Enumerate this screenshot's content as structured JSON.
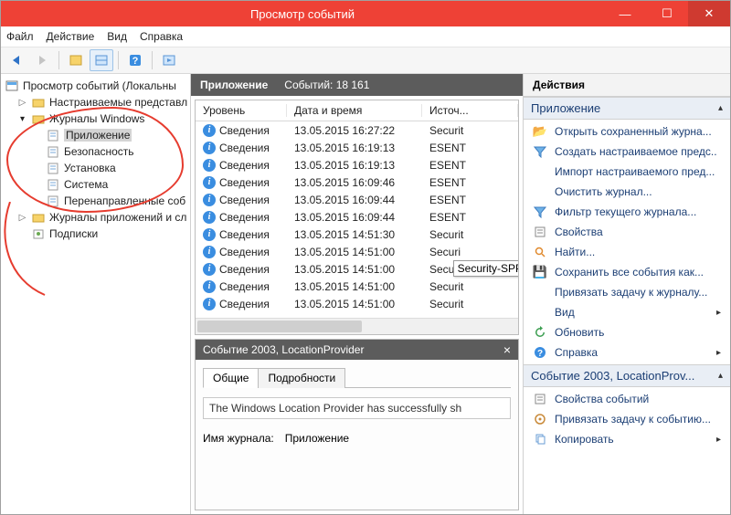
{
  "window": {
    "title": "Просмотр событий"
  },
  "menu": {
    "file": "Файл",
    "action": "Действие",
    "view": "Вид",
    "help": "Справка"
  },
  "tree": {
    "root": "Просмотр событий (Локальны",
    "custom": "Настраиваемые представл",
    "winlogs": "Журналы Windows",
    "application": "Приложение",
    "security": "Безопасность",
    "setup": "Установка",
    "system": "Система",
    "forwarded": "Перенаправленные соб",
    "applogs": "Журналы приложений и сл",
    "subs": "Подписки"
  },
  "list": {
    "title": "Приложение",
    "count_label": "Событий: 18 161",
    "col_level": "Уровень",
    "col_datetime": "Дата и время",
    "col_source": "Источ...",
    "level_info": "Сведения",
    "rows": [
      {
        "dt": "13.05.2015 16:27:22",
        "src": "Securit"
      },
      {
        "dt": "13.05.2015 16:19:13",
        "src": "ESENT"
      },
      {
        "dt": "13.05.2015 16:19:13",
        "src": "ESENT"
      },
      {
        "dt": "13.05.2015 16:09:46",
        "src": "ESENT"
      },
      {
        "dt": "13.05.2015 16:09:44",
        "src": "ESENT"
      },
      {
        "dt": "13.05.2015 16:09:44",
        "src": "ESENT"
      },
      {
        "dt": "13.05.2015 14:51:30",
        "src": "Securit"
      },
      {
        "dt": "13.05.2015 14:51:00",
        "src": "Securi"
      },
      {
        "dt": "13.05.2015 14:51:00",
        "src": "Secu"
      },
      {
        "dt": "13.05.2015 14:51:00",
        "src": "Securit"
      },
      {
        "dt": "13.05.2015 14:51:00",
        "src": "Securit"
      }
    ]
  },
  "tooltip": "Security-SPP",
  "detail": {
    "title": "Событие 2003, LocationProvider",
    "tab_general": "Общие",
    "tab_details": "Подробности",
    "message": "The Windows Location Provider has successfully sh",
    "logname_label": "Имя журнала:",
    "logname_value": "Приложение"
  },
  "actions": {
    "header": "Действия",
    "group1_title": "Приложение",
    "group1": {
      "open": "Открыть сохраненный журна...",
      "custom": "Создать настраиваемое предс..",
      "import": "Импорт настраиваемого пред...",
      "clear": "Очистить журнал...",
      "filter": "Фильтр текущего журнала...",
      "props": "Свойства",
      "find": "Найти...",
      "saveall": "Сохранить все события как...",
      "attach": "Привязать задачу к журналу...",
      "view": "Вид",
      "refresh": "Обновить",
      "help": "Справка"
    },
    "group2_title": "Событие 2003, LocationProv...",
    "group2": {
      "evprops": "Свойства событий",
      "evattach": "Привязать задачу к событию...",
      "copy": "Копировать"
    }
  }
}
